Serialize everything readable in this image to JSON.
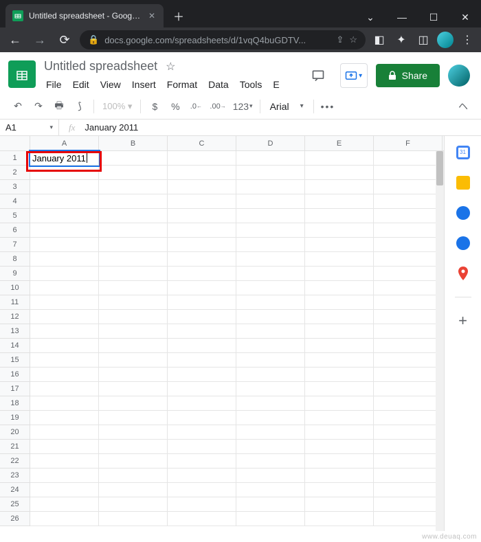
{
  "browser": {
    "tab_title": "Untitled spreadsheet - Google Sh",
    "url": "docs.google.com/spreadsheets/d/1vqQ4buGDTV..."
  },
  "doc": {
    "title": "Untitled spreadsheet",
    "menus": [
      "File",
      "Edit",
      "View",
      "Insert",
      "Format",
      "Data",
      "Tools",
      "E"
    ],
    "share_label": "Share"
  },
  "toolbar": {
    "zoom": "100%",
    "currency": "$",
    "percent": "%",
    "dec_dec": ".0",
    "dec_inc": ".00",
    "more_fmt": "123",
    "font": "Arial",
    "more": "•••"
  },
  "formula": {
    "name_box": "A1",
    "fx": "fx",
    "value": "January 2011"
  },
  "grid": {
    "columns": [
      "A",
      "B",
      "C",
      "D",
      "E",
      "F"
    ],
    "row_count": 26,
    "active_cell": {
      "row": 1,
      "col": "A",
      "value": "January 2011"
    }
  },
  "watermark": "www.deuaq.com"
}
